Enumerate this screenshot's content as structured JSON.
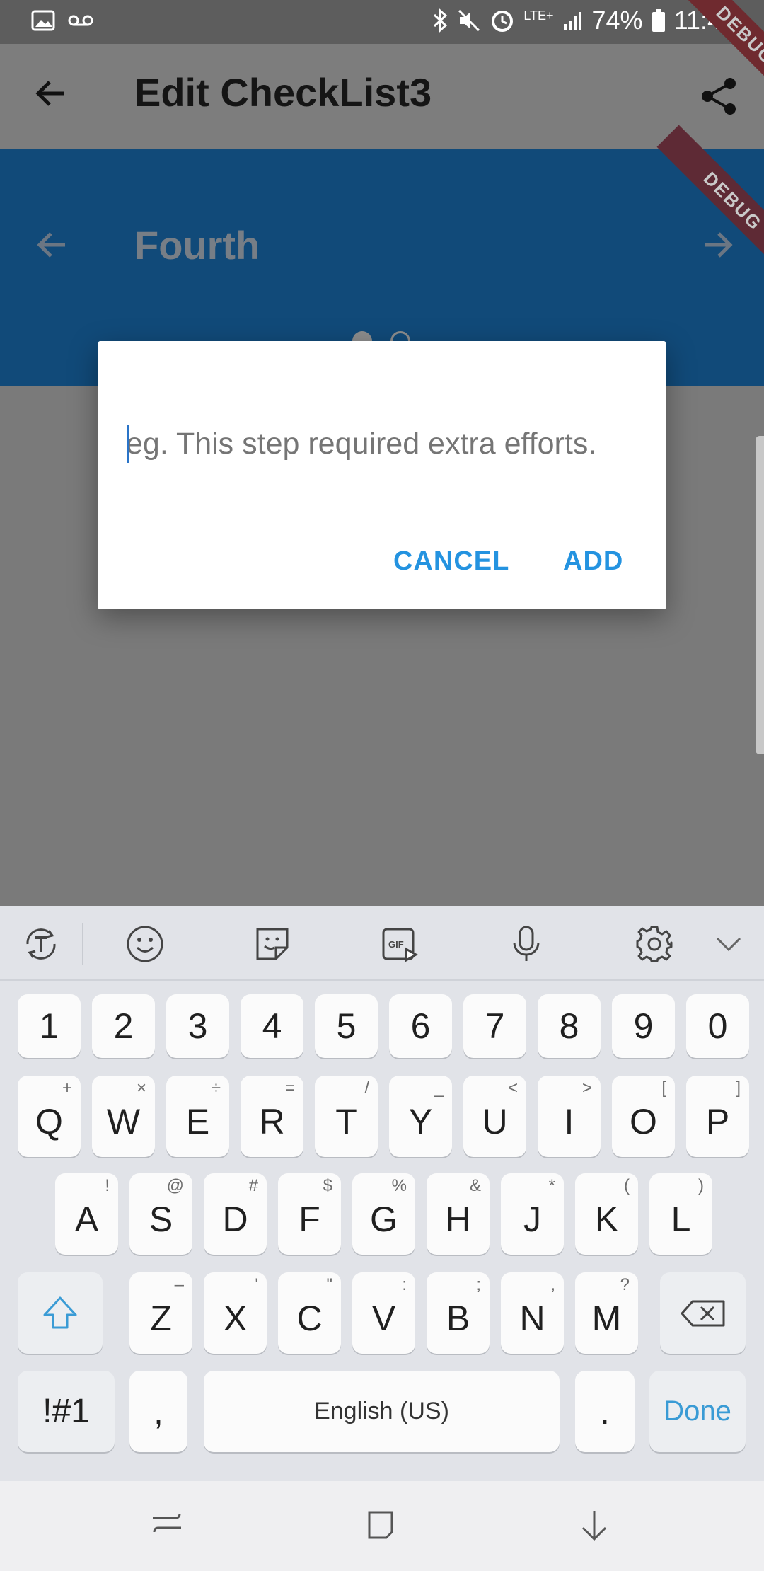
{
  "status_bar": {
    "battery": "74%",
    "time": "11:40",
    "network": "LTE+",
    "icons": [
      "image-icon",
      "voicemail-icon",
      "bluetooth-icon",
      "mute-icon",
      "alarm-icon",
      "signal-icon",
      "battery-icon"
    ]
  },
  "app_bar": {
    "title": "Edit CheckList3",
    "debug_label": "DEBUG"
  },
  "step_header": {
    "title": "Fourth",
    "debug_label": "DEBUG",
    "page_indicator": {
      "count": 2,
      "active": 1
    }
  },
  "dialog": {
    "input_placeholder": "eg. This step required extra efforts.",
    "input_value": "",
    "cancel_label": "CANCEL",
    "add_label": "ADD"
  },
  "keyboard": {
    "number_row": [
      "1",
      "2",
      "3",
      "4",
      "5",
      "6",
      "7",
      "8",
      "9",
      "0"
    ],
    "row1": [
      {
        "main": "Q",
        "sup": "+"
      },
      {
        "main": "W",
        "sup": "×"
      },
      {
        "main": "E",
        "sup": "÷"
      },
      {
        "main": "R",
        "sup": "="
      },
      {
        "main": "T",
        "sup": "/"
      },
      {
        "main": "Y",
        "sup": "_"
      },
      {
        "main": "U",
        "sup": "<"
      },
      {
        "main": "I",
        "sup": ">"
      },
      {
        "main": "O",
        "sup": "["
      },
      {
        "main": "P",
        "sup": "]"
      }
    ],
    "row2": [
      {
        "main": "A",
        "sup": "!"
      },
      {
        "main": "S",
        "sup": "@"
      },
      {
        "main": "D",
        "sup": "#"
      },
      {
        "main": "F",
        "sup": "$"
      },
      {
        "main": "G",
        "sup": "%"
      },
      {
        "main": "H",
        "sup": "&"
      },
      {
        "main": "J",
        "sup": "*"
      },
      {
        "main": "K",
        "sup": "("
      },
      {
        "main": "L",
        "sup": ")"
      }
    ],
    "row3": [
      {
        "main": "Z",
        "sup": "–"
      },
      {
        "main": "X",
        "sup": "'"
      },
      {
        "main": "C",
        "sup": "\""
      },
      {
        "main": "V",
        "sup": ":"
      },
      {
        "main": "B",
        "sup": ";"
      },
      {
        "main": "N",
        "sup": ","
      },
      {
        "main": "M",
        "sup": "?"
      }
    ],
    "symbols_label": "!#1",
    "comma_label": ",",
    "space_label": "English (US)",
    "period_label": ".",
    "done_label": "Done"
  }
}
